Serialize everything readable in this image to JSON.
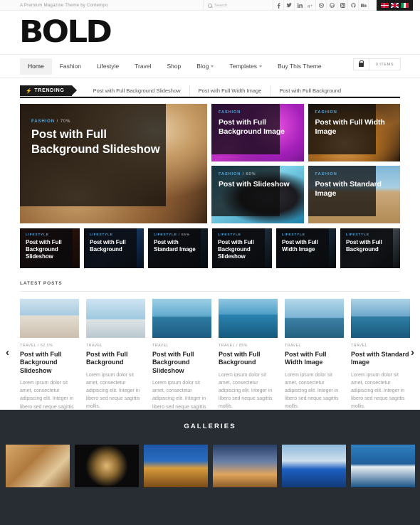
{
  "topbar": {
    "tagline": "A Premium Magazine Theme by Contempo",
    "search_placeholder": "Search",
    "social": [
      {
        "name": "facebook-icon",
        "glyph": "f"
      },
      {
        "name": "twitter-icon",
        "glyph": "t"
      },
      {
        "name": "linkedin-icon",
        "glyph": "in"
      },
      {
        "name": "google-plus-icon",
        "glyph": "g+"
      },
      {
        "name": "dribbble-icon",
        "glyph": "d"
      },
      {
        "name": "wordpress-icon",
        "glyph": "w"
      },
      {
        "name": "instagram-icon",
        "glyph": "ig"
      },
      {
        "name": "github-icon",
        "glyph": "gh"
      },
      {
        "name": "behance-icon",
        "glyph": "be"
      }
    ],
    "flags": [
      "denmark-flag",
      "united-kingdom-flag",
      "italy-flag"
    ]
  },
  "header": {
    "logo": "BOLD"
  },
  "nav": {
    "items": [
      {
        "label": "Home",
        "active": true,
        "dropdown": false
      },
      {
        "label": "Fashion",
        "active": false,
        "dropdown": false
      },
      {
        "label": "Lifestyle",
        "active": false,
        "dropdown": false
      },
      {
        "label": "Travel",
        "active": false,
        "dropdown": false
      },
      {
        "label": "Shop",
        "active": false,
        "dropdown": false
      },
      {
        "label": "Blog",
        "active": false,
        "dropdown": true
      },
      {
        "label": "Templates",
        "active": false,
        "dropdown": true
      },
      {
        "label": "Buy This Theme",
        "active": false,
        "dropdown": false
      }
    ],
    "cart_label": "0 ITEMS"
  },
  "trending": {
    "tag": "TRENDING",
    "items": [
      "Post with Full Background Slideshow",
      "Post with Full Width Image",
      "Post with Full Background"
    ]
  },
  "hero": {
    "featured": {
      "category": "FASHION",
      "percent": "/ 70%",
      "title": "Post with Full Background Slideshow",
      "image": "fashion-woman-vintage-sofa"
    },
    "cards": [
      {
        "category": "FASHION",
        "percent": "",
        "title": "Post with Full Background Image",
        "image": "purple-abstract"
      },
      {
        "category": "FASHION",
        "percent": "",
        "title": "Post with Full Width Image",
        "image": "warm-interior"
      },
      {
        "category": "FASHION",
        "percent": "/ 60%",
        "title": "Post with Slideshow",
        "image": "cyan-portrait"
      },
      {
        "category": "FASHION",
        "percent": "",
        "title": "Post with Standard Image",
        "image": "desert-landscape"
      }
    ]
  },
  "lifestyle_row": [
    {
      "category": "LIFESTYLE",
      "percent": "",
      "title": "Post with Full Background Slideshow"
    },
    {
      "category": "LIFESTYLE",
      "percent": "",
      "title": "Post with Full Background"
    },
    {
      "category": "LIFESTYLE",
      "percent": "/ 55%",
      "title": "Post with Standard Image"
    },
    {
      "category": "LIFESTYLE",
      "percent": "",
      "title": "Post with Full Background Slideshow"
    },
    {
      "category": "LIFESTYLE",
      "percent": "",
      "title": "Post with Full Width Image"
    },
    {
      "category": "LIFESTYLE",
      "percent": "",
      "title": "Post with Full Background"
    }
  ],
  "latest": {
    "heading": "LATEST POSTS",
    "prev_label": "‹",
    "next_label": "›",
    "excerpt": "Lorem ipsum dolor sit amet, consectetur adipiscing elit. Integer in libero sed neque sagittis mollis.",
    "posts": [
      {
        "meta": "TRAVEL / 62.5%",
        "title": "Post with Full Background Slideshow"
      },
      {
        "meta": "TRAVEL",
        "title": "Post with Full Background"
      },
      {
        "meta": "TRAVEL",
        "title": "Post with Full Background Slideshow"
      },
      {
        "meta": "TRAVEL / 85%",
        "title": "Post with Full Background"
      },
      {
        "meta": "TRAVEL",
        "title": "Post with Full Width Image"
      },
      {
        "meta": "TRAVEL",
        "title": "Post with Standard Image"
      }
    ]
  },
  "galleries": {
    "title": "GALLERIES",
    "items": [
      "fashion-vintage-gallery",
      "luxury-watch-gallery",
      "mountain-lodge-gallery",
      "private-jet-gallery",
      "blue-sports-car-gallery",
      "luxury-yacht-gallery"
    ]
  },
  "colors": {
    "accent": "#4ea8e0",
    "dark": "#1b1b1b",
    "galleries_bg": "#282c33"
  }
}
